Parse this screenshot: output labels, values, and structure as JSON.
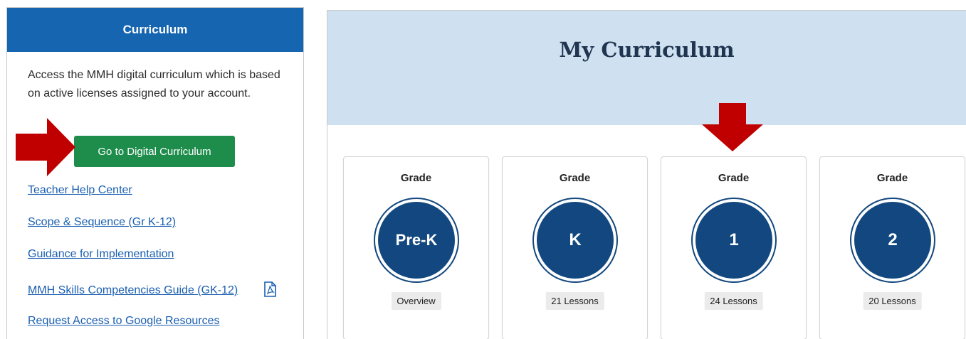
{
  "curriculum_panel": {
    "title": "Curriculum",
    "description": "Access the MMH digital curriculum which is based on active licenses assigned to your account.",
    "go_button_label": "Go to Digital Curriculum",
    "links": [
      "Teacher Help Center",
      "Scope & Sequence (Gr K-12)",
      "Guidance for Implementation",
      "MMH Skills Competencies Guide (GK-12)",
      "Request Access to Google Resources"
    ],
    "pdf_icon": "pdf-file-icon",
    "colors": {
      "header": "#1565b0",
      "button": "#1e8d4c",
      "link": "#1a5fb0"
    }
  },
  "my_curriculum": {
    "title": "My Curriculum",
    "banner_color": "#cfe1f1",
    "grades": [
      {
        "label": "Grade",
        "value": "Pre-K",
        "chip": "Overview"
      },
      {
        "label": "Grade",
        "value": "K",
        "chip": "21 Lessons"
      },
      {
        "label": "Grade",
        "value": "1",
        "chip": "24 Lessons"
      },
      {
        "label": "Grade",
        "value": "2",
        "chip": "20 Lessons"
      }
    ],
    "circle_color": "#12487f"
  },
  "annotations": {
    "arrow_color": "#c00000",
    "arrows": [
      "red-arrow-right-icon",
      "red-arrow-down-icon"
    ]
  }
}
